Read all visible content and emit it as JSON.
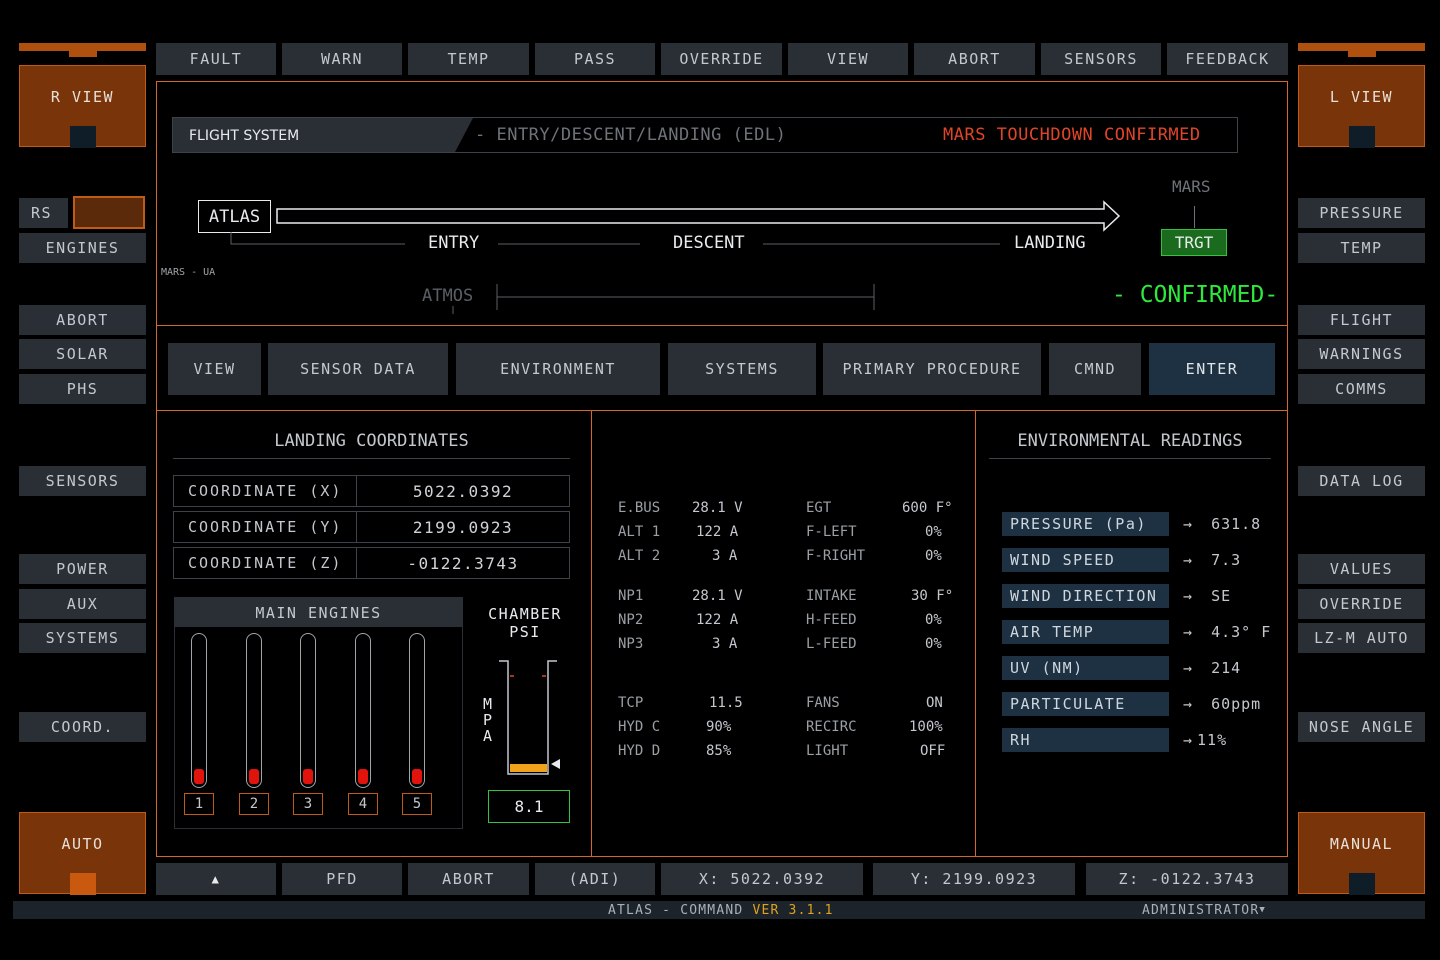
{
  "top_nav": [
    "FAULT",
    "WARN",
    "TEMP",
    "PASS",
    "OVERRIDE",
    "VIEW",
    "ABORT",
    "SENSORS",
    "FEEDBACK"
  ],
  "left_panel": {
    "view_label": "R VIEW",
    "rs_label": "RS",
    "engines": "ENGINES",
    "group1": [
      "ABORT",
      "SOLAR",
      "PHS"
    ],
    "sensors": "SENSORS",
    "group2": [
      "POWER",
      "AUX",
      "SYSTEMS"
    ],
    "coord": "COORD.",
    "mode": "AUTO"
  },
  "right_panel": {
    "view_label": "L VIEW",
    "group0": [
      "PRESSURE",
      "TEMP"
    ],
    "group1": [
      "FLIGHT",
      "WARNINGS",
      "COMMS"
    ],
    "data_log": "DATA LOG",
    "group2": [
      "VALUES",
      "OVERRIDE",
      "LZ-M AUTO"
    ],
    "nose_angle": "NOSE ANGLE",
    "mode": "MANUAL"
  },
  "flight": {
    "system_label": "FLIGHT SYSTEM",
    "phase_title": "- ENTRY/DESCENT/LANDING (EDL)",
    "status": "MARS TOUCHDOWN CONFIRMED",
    "origin": "ATLAS",
    "origin_sub": "MARS - UA",
    "stages": [
      "ENTRY",
      "DESCENT",
      "LANDING"
    ],
    "target_top": "MARS",
    "target": "TRGT",
    "atmos": "ATMOS",
    "confirmed": "- CONFIRMED-"
  },
  "tabs": [
    "VIEW",
    "SENSOR DATA",
    "ENVIRONMENT",
    "SYSTEMS",
    "PRIMARY PROCEDURE",
    "CMND",
    "ENTER"
  ],
  "landing": {
    "title": "LANDING COORDINATES",
    "rows": [
      {
        "label": "COORDINATE  (X)",
        "value": "5022.0392"
      },
      {
        "label": "COORDINATE  (Y)",
        "value": "2199.0923"
      },
      {
        "label": "COORDINATE  (Z)",
        "value": "-0122.3743"
      }
    ]
  },
  "engines": {
    "title": "MAIN ENGINES",
    "numbers": [
      "1",
      "2",
      "3",
      "4",
      "5"
    ],
    "chamber_title_1": "CHAMBER",
    "chamber_title_2": "PSI",
    "axis_label": [
      "M",
      "P",
      "A"
    ],
    "chamber_value": "8.1"
  },
  "systems": {
    "left": [
      [
        [
          "E.BUS",
          "28.1 V"
        ],
        [
          "ALT 1",
          "122 A"
        ],
        [
          "ALT 2",
          "3 A"
        ]
      ],
      [
        [
          "NP1",
          "28.1 V"
        ],
        [
          "NP2",
          "122 A"
        ],
        [
          "NP3",
          "3 A"
        ]
      ],
      [
        [
          "TCP",
          "11.5"
        ],
        [
          "HYD C",
          "90%"
        ],
        [
          "HYD D",
          "85%"
        ]
      ]
    ],
    "right": [
      [
        [
          "EGT",
          "600 F°"
        ],
        [
          "F-LEFT",
          "0%"
        ],
        [
          "F-RIGHT",
          "0%"
        ]
      ],
      [
        [
          "INTAKE",
          "30 F°"
        ],
        [
          "H-FEED",
          "0%"
        ],
        [
          "L-FEED",
          "0%"
        ]
      ],
      [
        [
          "FANS",
          "ON"
        ],
        [
          "RECIRC",
          "100%"
        ],
        [
          "LIGHT",
          "OFF"
        ]
      ]
    ]
  },
  "environment": {
    "title": "ENVIRONMENTAL READINGS",
    "rows": [
      {
        "label": "PRESSURE (Pa)",
        "value": "631.8"
      },
      {
        "label": "WIND SPEED",
        "value": "7.3"
      },
      {
        "label": "WIND DIRECTION",
        "value": "SE"
      },
      {
        "label": "AIR TEMP",
        "value": "4.3° F"
      },
      {
        "label": "UV (NM)",
        "value": "214"
      },
      {
        "label": "PARTICULATE",
        "value": "60ppm"
      },
      {
        "label": "RH",
        "value": "11%"
      }
    ]
  },
  "bottom_bar": {
    "up_arrow": "▲",
    "items": [
      "PFD",
      "ABORT",
      "(ADI)"
    ],
    "x": "X: 5022.0392",
    "y": "Y: 2199.0923",
    "z": "Z: -0122.3743"
  },
  "footer": {
    "app": "ATLAS - COMMAND",
    "version": "VER 3.1.1",
    "user": "ADMINISTRATOR"
  },
  "colors": {
    "accent": "#d4682a",
    "panel_orange": "#7a3409",
    "status_red": "#e0452a",
    "confirm_green": "#2ee83c",
    "version_yellow": "#e0a21c"
  }
}
